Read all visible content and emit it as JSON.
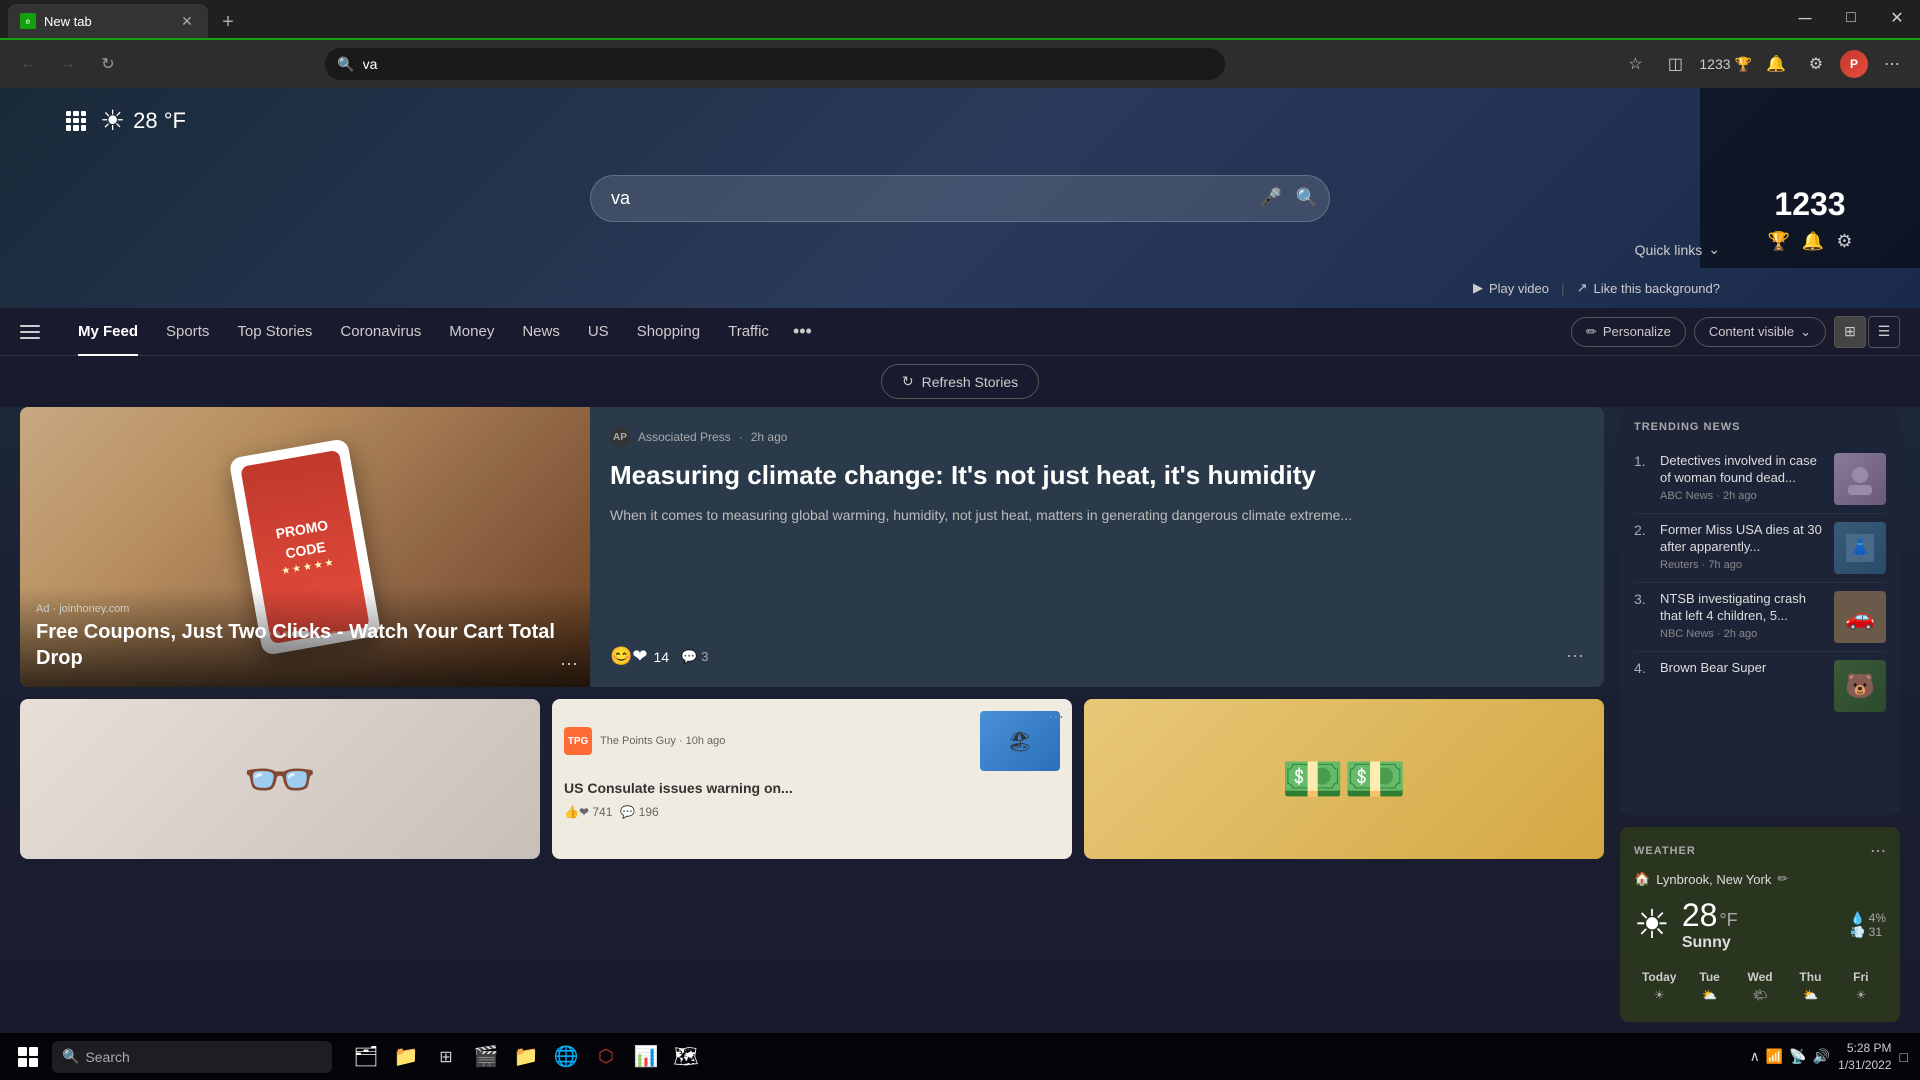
{
  "browser": {
    "tab_label": "New tab",
    "tab_favicon": "🌐",
    "address_value": "va"
  },
  "toolbar": {
    "favorites_icon": "★",
    "collections_icon": "◫",
    "profile_initials": "P",
    "more_icon": "⋯",
    "score": "1233"
  },
  "hero": {
    "grid_icon": "⋮⋮⋮",
    "weather_emoji": "☀",
    "temperature": "28 °F",
    "search_placeholder": "va",
    "mic_icon": "🎤",
    "search_icon": "🔍",
    "quick_links_label": "Quick links",
    "play_video_label": "Play video",
    "like_bg_label": "Like this background?"
  },
  "nav": {
    "items": [
      {
        "label": "My Feed",
        "active": true
      },
      {
        "label": "Sports",
        "active": false
      },
      {
        "label": "Top Stories",
        "active": false
      },
      {
        "label": "Coronavirus",
        "active": false
      },
      {
        "label": "Money",
        "active": false
      },
      {
        "label": "News",
        "active": false
      },
      {
        "label": "US",
        "active": false
      },
      {
        "label": "Shopping",
        "active": false
      },
      {
        "label": "Traffic",
        "active": false
      }
    ],
    "more_label": "...",
    "personalize_label": "Personalize",
    "content_visible_label": "Content visible",
    "grid_view_icon": "⊞",
    "list_view_icon": "☰"
  },
  "refresh": {
    "label": "Refresh Stories",
    "icon": "↻"
  },
  "featured": {
    "left": {
      "ad_source": "Ad · joinhoney.com",
      "title": "Free Coupons, Just Two Clicks - Watch Your Cart Total Drop",
      "promo_line1": "PROMO",
      "promo_line2": "CODE"
    },
    "right": {
      "source": "Associated Press",
      "time_ago": "2h ago",
      "title": "Measuring climate change: It's not just heat, it's humidity",
      "description": "When it comes to measuring global warming, humidity, not just heat, matters in generating dangerous climate extreme...",
      "reaction_count": "14",
      "comment_count": "3"
    }
  },
  "small_cards": [
    {
      "type": "glasses",
      "emoji": "👓"
    },
    {
      "type": "travel",
      "source_name": "The Points Guy",
      "time_ago": "10h ago",
      "title": "US Consulate issues warning on...",
      "reaction_count": "741",
      "comment_count": "196"
    },
    {
      "type": "money",
      "emoji": "💵"
    }
  ],
  "trending": {
    "label": "TRENDING NEWS",
    "items": [
      {
        "num": "1.",
        "headline": "Detectives involved in case of woman found dead...",
        "source": "ABC News",
        "time_ago": "2h ago"
      },
      {
        "num": "2.",
        "headline": "Former Miss USA dies at 30 after apparently...",
        "source": "Reuters",
        "time_ago": "7h ago"
      },
      {
        "num": "3.",
        "headline": "NTSB investigating crash that left 4 children, 5...",
        "source": "NBC News",
        "time_ago": "2h ago"
      },
      {
        "num": "4.",
        "headline": "Brown Bear Super",
        "source": "",
        "time_ago": ""
      }
    ]
  },
  "weather": {
    "label": "WEATHER",
    "location": "Lynbrook, New York",
    "condition": "Sunny",
    "temperature": "28",
    "unit": "°F",
    "precipitation": "4%",
    "wind": "31",
    "forecast": [
      {
        "label": "Today"
      },
      {
        "label": "Tue"
      },
      {
        "label": "Wed"
      },
      {
        "label": "Thu"
      },
      {
        "label": "Fri"
      }
    ]
  },
  "taskbar": {
    "search_placeholder": "Search",
    "clock_time": "5:28 PM",
    "clock_date": "1/31/2022",
    "apps": [
      "🗂",
      "🔍",
      "📁",
      "⊞",
      "🎬",
      "📁",
      "🌐",
      "📊",
      "🗺"
    ]
  }
}
